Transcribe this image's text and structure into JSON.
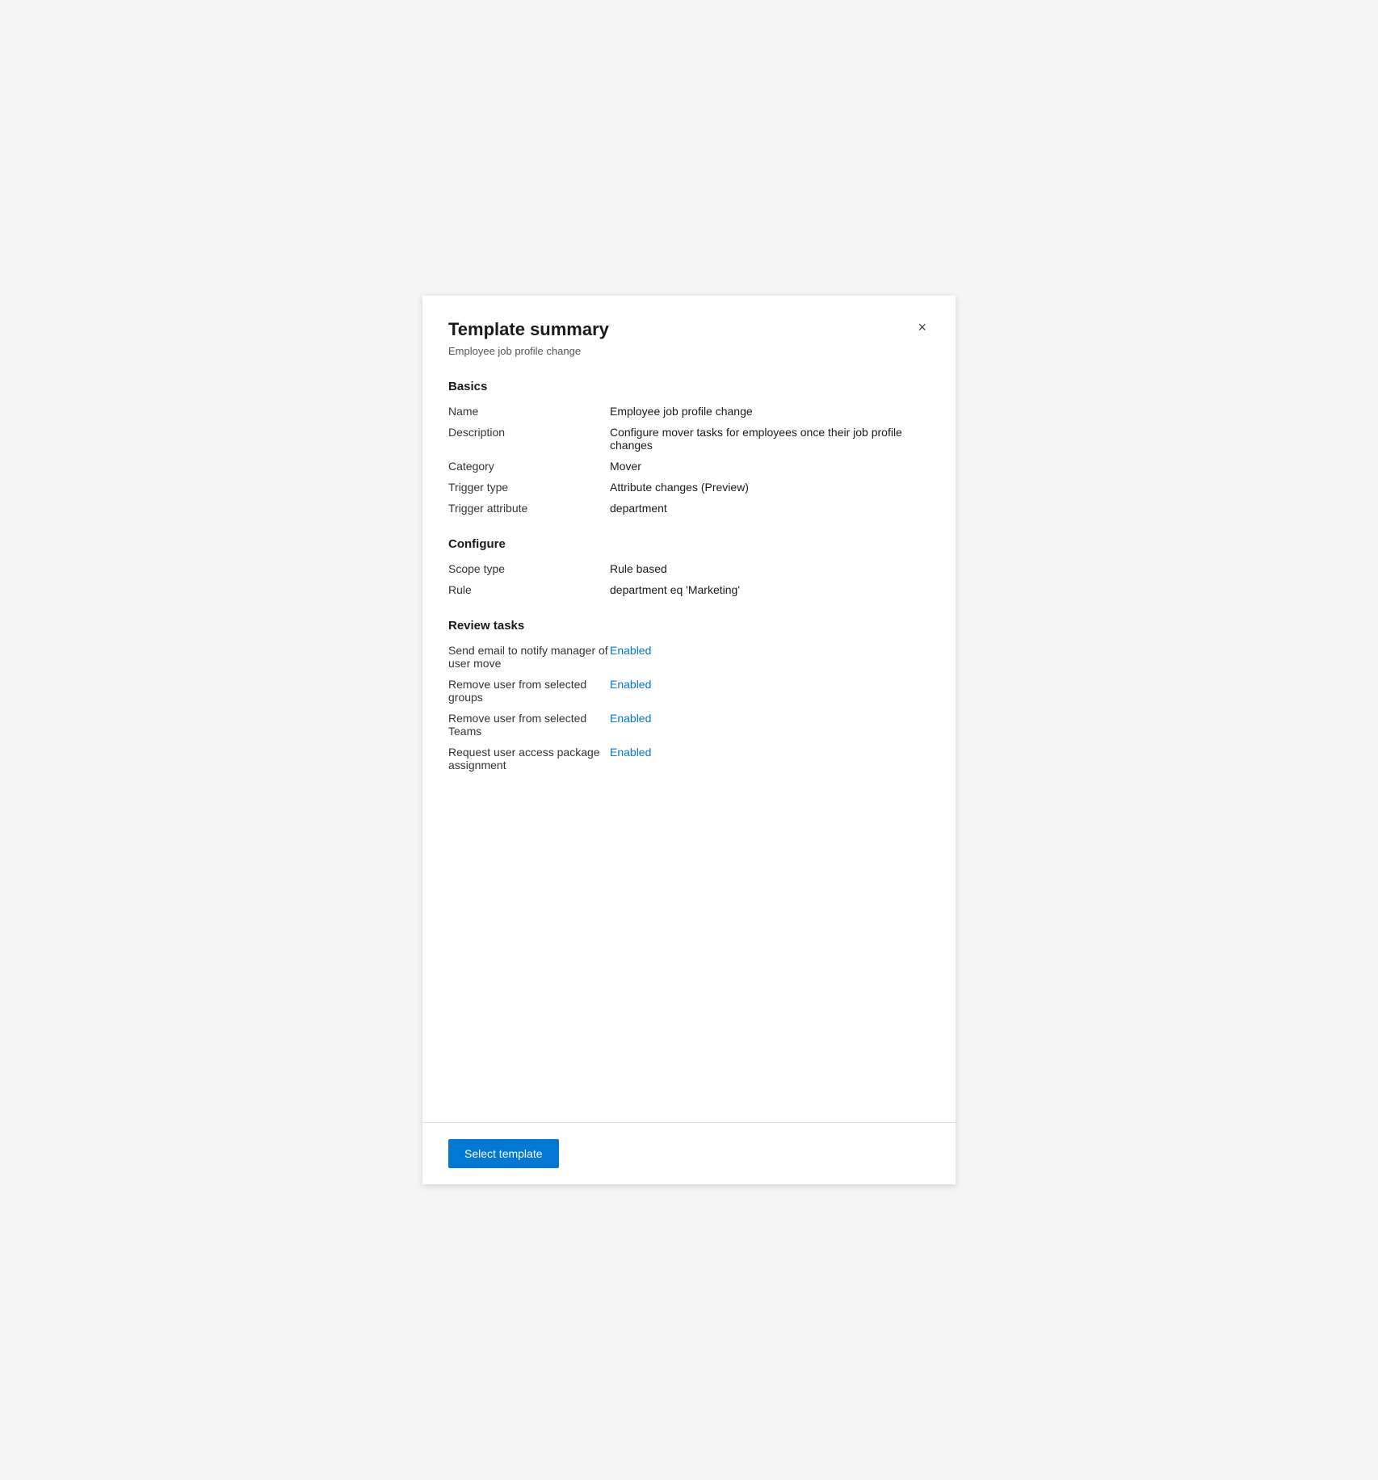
{
  "panel": {
    "title": "Template summary",
    "subtitle": "Employee job profile change",
    "close_icon": "×"
  },
  "sections": {
    "basics": {
      "heading": "Basics",
      "rows": [
        {
          "label": "Name",
          "value": "Employee job profile change",
          "enabled": false
        },
        {
          "label": "Description",
          "value": "Configure mover tasks for employees once their job profile changes",
          "enabled": false
        },
        {
          "label": "Category",
          "value": "Mover",
          "enabled": false
        },
        {
          "label": "Trigger type",
          "value": "Attribute changes (Preview)",
          "enabled": false
        },
        {
          "label": "Trigger attribute",
          "value": "department",
          "enabled": false
        }
      ]
    },
    "configure": {
      "heading": "Configure",
      "rows": [
        {
          "label": "Scope type",
          "value": "Rule based",
          "enabled": false
        },
        {
          "label": "Rule",
          "value": "department eq 'Marketing'",
          "enabled": false
        }
      ]
    },
    "review_tasks": {
      "heading": "Review tasks",
      "rows": [
        {
          "label": "Send email to notify manager of user move",
          "value": "Enabled",
          "enabled": true
        },
        {
          "label": "Remove user from selected groups",
          "value": "Enabled",
          "enabled": true
        },
        {
          "label": "Remove user from selected Teams",
          "value": "Enabled",
          "enabled": true
        },
        {
          "label": "Request user access package assignment",
          "value": "Enabled",
          "enabled": true
        }
      ]
    }
  },
  "footer": {
    "select_template_label": "Select template"
  }
}
